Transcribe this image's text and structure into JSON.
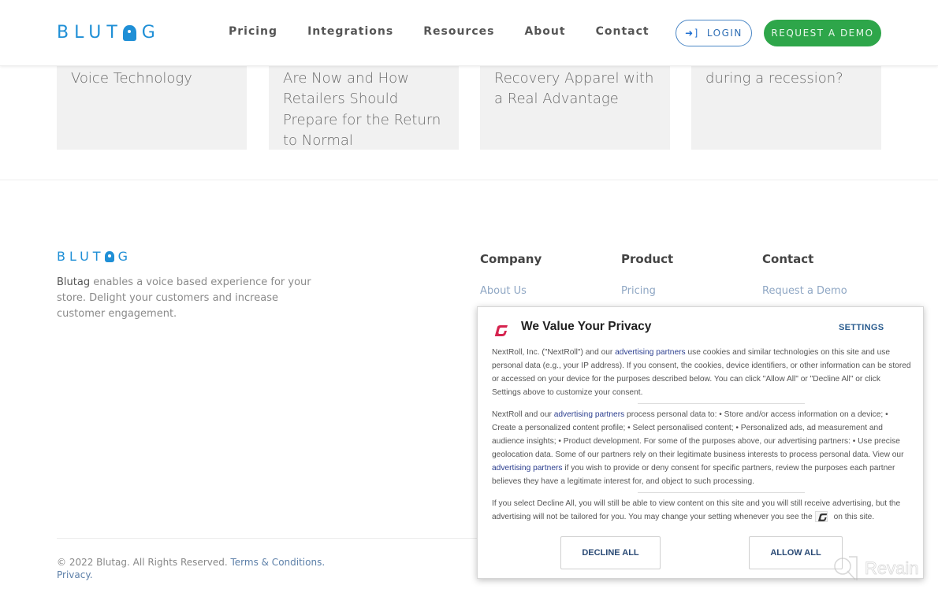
{
  "header": {
    "logo": "BLUTAG",
    "nav": [
      "Pricing",
      "Integrations",
      "Resources",
      "About",
      "Contact"
    ],
    "login_label": "LOGIN",
    "demo_label": "REQUEST A DEMO"
  },
  "cards": [
    {
      "title": "Why Consumers Love Voice Technology"
    },
    {
      "title": "Shortage - Where We Are Now and How Retailers Should Prepare for the Return to Normal"
    },
    {
      "title": "Compression - Recovery Apparel with a Real Advantage"
    },
    {
      "title": "survive, but thrive during a recession?"
    }
  ],
  "footer": {
    "logo": "BLUTAG",
    "about_brand": "Blutag",
    "about_text": " enables a voice based experience for your store. Delight your customers and increase customer engagement.",
    "columns": [
      {
        "heading": "Company",
        "links": [
          "About Us"
        ]
      },
      {
        "heading": "Product",
        "links": [
          "Pricing"
        ]
      },
      {
        "heading": "Contact",
        "links": [
          "Request a Demo"
        ]
      }
    ],
    "copyright": "© 2022 Blutag. All Rights Reserved. ",
    "terms_label": "Terms & Conditions.",
    "privacy_label": "Privacy."
  },
  "consent": {
    "title": "We Value Your Privacy",
    "settings_label": "SETTINGS",
    "p1_a": "NextRoll, Inc. (\"NextRoll\") and our ",
    "p1_link": "advertising partners",
    "p1_b": " use cookies and similar technologies on this site and use personal data (e.g., your IP address). If you consent, the cookies, device identifiers, or other information can be stored or accessed on your device for the purposes described below. You can click \"Allow All\" or \"Decline All\" or click Settings above to customize your consent.",
    "p2_a": "NextRoll and our ",
    "p2_link": "advertising partners",
    "p2_b": " process personal data to: • Store and/or access information on a device; • Create a personalized content profile; • Select personalised content; • Personalized ads, ad measurement and audience insights; • Product development. For some of the purposes above, our advertising partners: • Use precise geolocation data. Some of our partners rely on their legitimate business interests to process personal data. View our ",
    "p2_link2": "advertising partners",
    "p2_c": " if you wish to provide or deny consent for specific partners, review the purposes each partner believes they have a legitimate interest for, and object to such processing.",
    "p3_a": "If you select Decline All, you will still be able to view content on this site and you will still receive advertising, but the advertising will not be tailored for you. You may change your setting whenever you see the",
    "p3_b": "on this site.",
    "decline_label": "DECLINE ALL",
    "allow_label": "ALLOW ALL",
    "brand_color": "#d6244f"
  },
  "watermark": "Revain"
}
